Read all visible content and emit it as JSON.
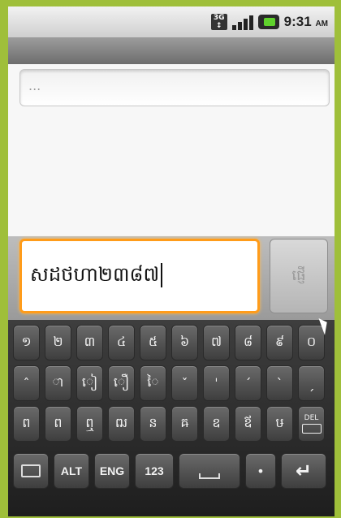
{
  "status_bar": {
    "time": "9:31",
    "ampm": "AM",
    "network_icon": "3g-icon",
    "signal_icon": "signal-icon",
    "battery_icon": "battery-icon"
  },
  "conversation": {
    "placeholder": "..."
  },
  "compose": {
    "message_text": "សដថហា២៣៨៧",
    "send_label": "ផ្ញើ"
  },
  "keyboard": {
    "row1": [
      "១",
      "២",
      "៣",
      "៤",
      "៥",
      "៦",
      "៧",
      "៨",
      "៩",
      "០"
    ],
    "row2": [
      "ˆ",
      "ា",
      "ៀ",
      "ឿ",
      "ៃ",
      "ˇ",
      "ˈ",
      "ˊ",
      "ˋ",
      "ˏ"
    ],
    "row3": [
      "ព",
      "ព",
      "ឮ",
      "ឍ",
      "ន",
      "ឝ",
      "ឧ",
      "ឪ",
      "ឞ"
    ],
    "delete_label": "DEL",
    "bottom": {
      "keyboard_icon": "keyboard-icon",
      "alt": "ALT",
      "eng": "ENG",
      "numbers": "123",
      "space_icon": "space-icon",
      "dot": "•",
      "enter_icon": "enter-icon"
    }
  },
  "colors": {
    "background": "#9fbf3a",
    "focus": "#ff9c1a"
  }
}
